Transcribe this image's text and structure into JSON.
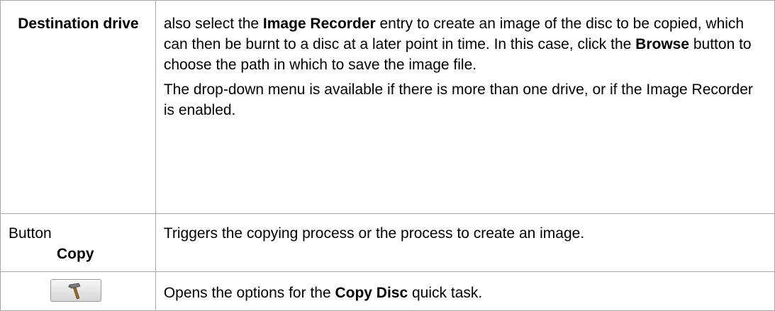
{
  "rows": [
    {
      "left_label": "Destination drive",
      "right": {
        "p1": [
          "also select the ",
          "Image Recorder",
          " entry to create an image of the disc to be copied, which can then be burnt to a disc at a later point in time. In this case, click the ",
          "Browse",
          " button to choose the path in which to save the image file."
        ],
        "p2": "The drop-down menu is available if there is more than one drive, or if the Image Recorder is enabled."
      }
    },
    {
      "left_label_line1": "Button",
      "left_label_line2": "Copy",
      "right_text": "Triggers the copying process or the process to create an image."
    },
    {
      "left_icon": "hammer-icon",
      "right": [
        "Opens the options for the ",
        "Copy Disc",
        " quick task."
      ]
    }
  ],
  "colors": {
    "border": "#a6a6a6",
    "text": "#000000"
  }
}
